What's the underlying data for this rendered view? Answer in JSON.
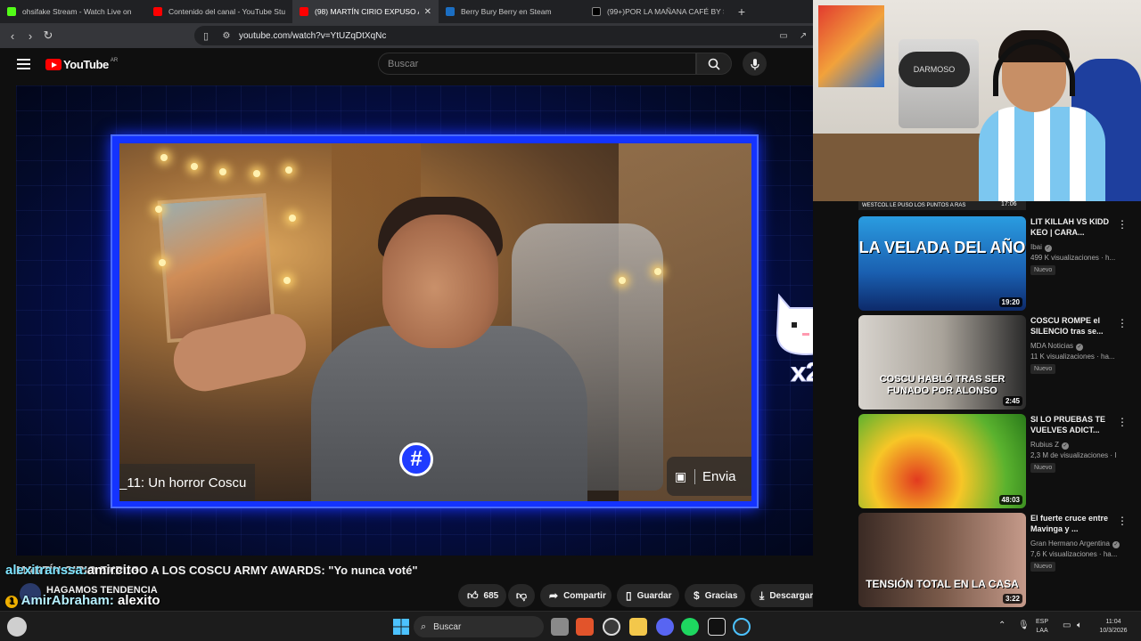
{
  "browser": {
    "tabs": [
      {
        "title": "ohsifake Stream - Watch Live on",
        "favicon_color": "#53fc18"
      },
      {
        "title": "Contenido del canal - YouTube Studi",
        "favicon_color": "#ff0000"
      },
      {
        "title": "(98) MARTÍN CIRIO EXPUSO A",
        "favicon_color": "#ff0000",
        "active": true
      },
      {
        "title": "Berry Bury Berry en Steam",
        "favicon_color": "#1b6ec2"
      },
      {
        "title": "(99+)POR LA MAÑANA CAFÉ BY SEB",
        "favicon_color": "#000000"
      }
    ],
    "url": "youtube.com/watch?v=YtUZqDtXqNc"
  },
  "youtube": {
    "logo_text": "YouTube",
    "country_code": "AR",
    "search_placeholder": "Buscar"
  },
  "video": {
    "caption": "_11: Un horror Coscu",
    "send_label": "Envia",
    "title": "MARTÍN CIRIO EXPUSO A LOS COSCU ARMY AWARDS: \"Yo nunca voté\"",
    "channel": "HAGAMOS TENDENCIA",
    "likes": "685",
    "share_label": "Compartir",
    "save_label": "Guardar",
    "thanks_label": "Gracias",
    "download_label": "Descargar",
    "emote_text": "x2"
  },
  "chat_overlay": [
    {
      "user": "alexitranssa:",
      "message": "amircito"
    },
    {
      "user": "AmirAbraham:",
      "message": "alexito",
      "badge": "1"
    }
  ],
  "webcam": {
    "jar_label": "DARMOSO"
  },
  "sidebar": {
    "top_thumb_label": "WESTCOL LE PUSO LOS PUNTOS A RAS",
    "top_thumb_duration": "17:06",
    "recommendations": [
      {
        "title": "LIT KILLAH VS KIDD KEO | CARA...",
        "channel": "Ibai",
        "views": "499 K visualizaciones · h...",
        "badge": "Nuevo",
        "duration": "19:20",
        "thumb_text": "LA VELADA DEL AÑO"
      },
      {
        "title": "COSCU ROMPE el SILENCIO tras se...",
        "channel": "MDA Noticias",
        "views": "11 K visualizaciones · ha...",
        "badge": "Nuevo",
        "duration": "2:45",
        "thumb_text": "COSCU HABLÓ TRAS SER FUNADO POR ALONSO"
      },
      {
        "title": "SI LO PRUEBAS TE VUELVES ADICT...",
        "channel": "Rubius Z",
        "views": "2,3 M de visualizaciones · I",
        "badge": "Nuevo",
        "duration": "48:03",
        "thumb_text": ""
      },
      {
        "title": "El fuerte cruce entre Mavinga y ...",
        "channel": "Gran Hermano Argentina",
        "views": "7,6 K visualizaciones · ha...",
        "badge": "Nuevo",
        "duration": "3:22",
        "thumb_text": "TENSIÓN TOTAL EN LA CASA"
      }
    ]
  },
  "taskbar": {
    "search_placeholder": "Buscar",
    "lang_top": "ESP",
    "lang_bottom": "LAA",
    "time": "11:04",
    "date": "10/3/2026"
  }
}
